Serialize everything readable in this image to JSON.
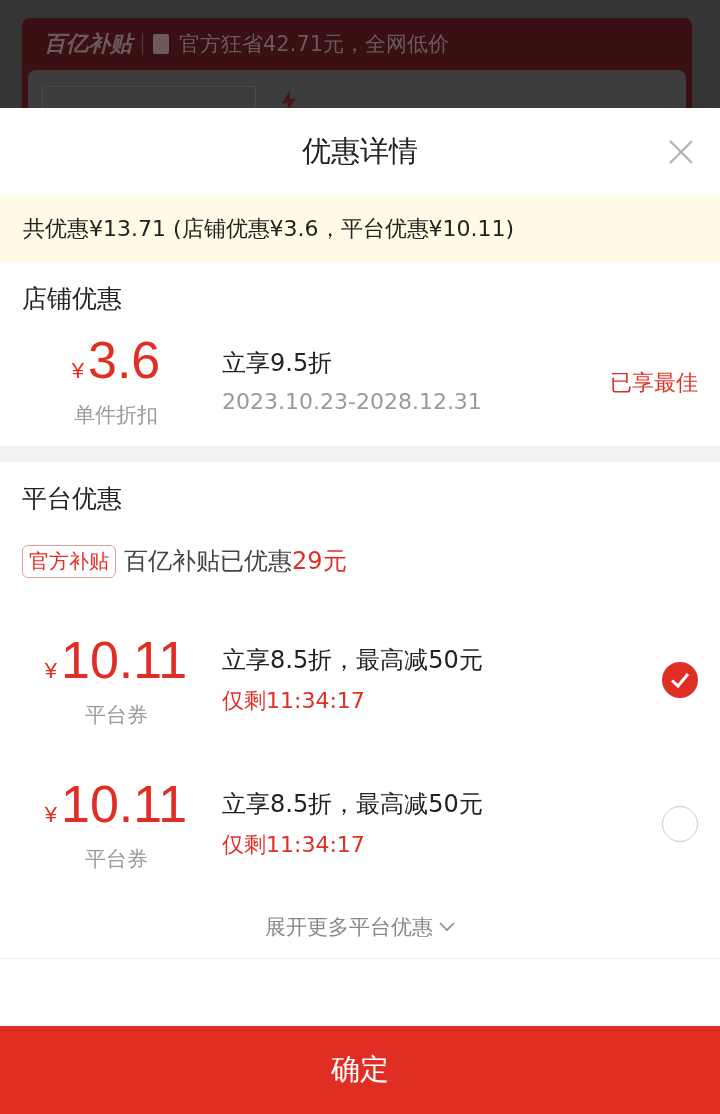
{
  "background_page": {
    "logo": "百亿补贴",
    "slogan": "官方狂省42.71元，全网低价"
  },
  "sheet": {
    "title": "优惠详情",
    "summary": "共优惠¥13.71 (店铺优惠¥3.6，平台优惠¥10.11)",
    "store_section": {
      "heading": "店铺优惠",
      "offers": [
        {
          "currency": "¥",
          "amount": "3.6",
          "type": "单件折扣",
          "title": "立享9.5折",
          "validity": "2023.10.23-2028.12.31",
          "status": "已享最佳"
        }
      ]
    },
    "platform_section": {
      "heading": "平台优惠",
      "tag": "官方补贴",
      "subsidy_text": "百亿补贴已优惠",
      "subsidy_amount": "29元",
      "coupons": [
        {
          "currency": "¥",
          "amount": "10.11",
          "type": "平台券",
          "title": "立享8.5折，最高减50元",
          "countdown": "仅剩11:34:17",
          "selected": true
        },
        {
          "currency": "¥",
          "amount": "10.11",
          "type": "平台券",
          "title": "立享8.5折，最高减50元",
          "countdown": "仅剩11:34:17",
          "selected": false
        }
      ],
      "expand_link": "展开更多平台优惠"
    },
    "confirm_button": "确定"
  }
}
